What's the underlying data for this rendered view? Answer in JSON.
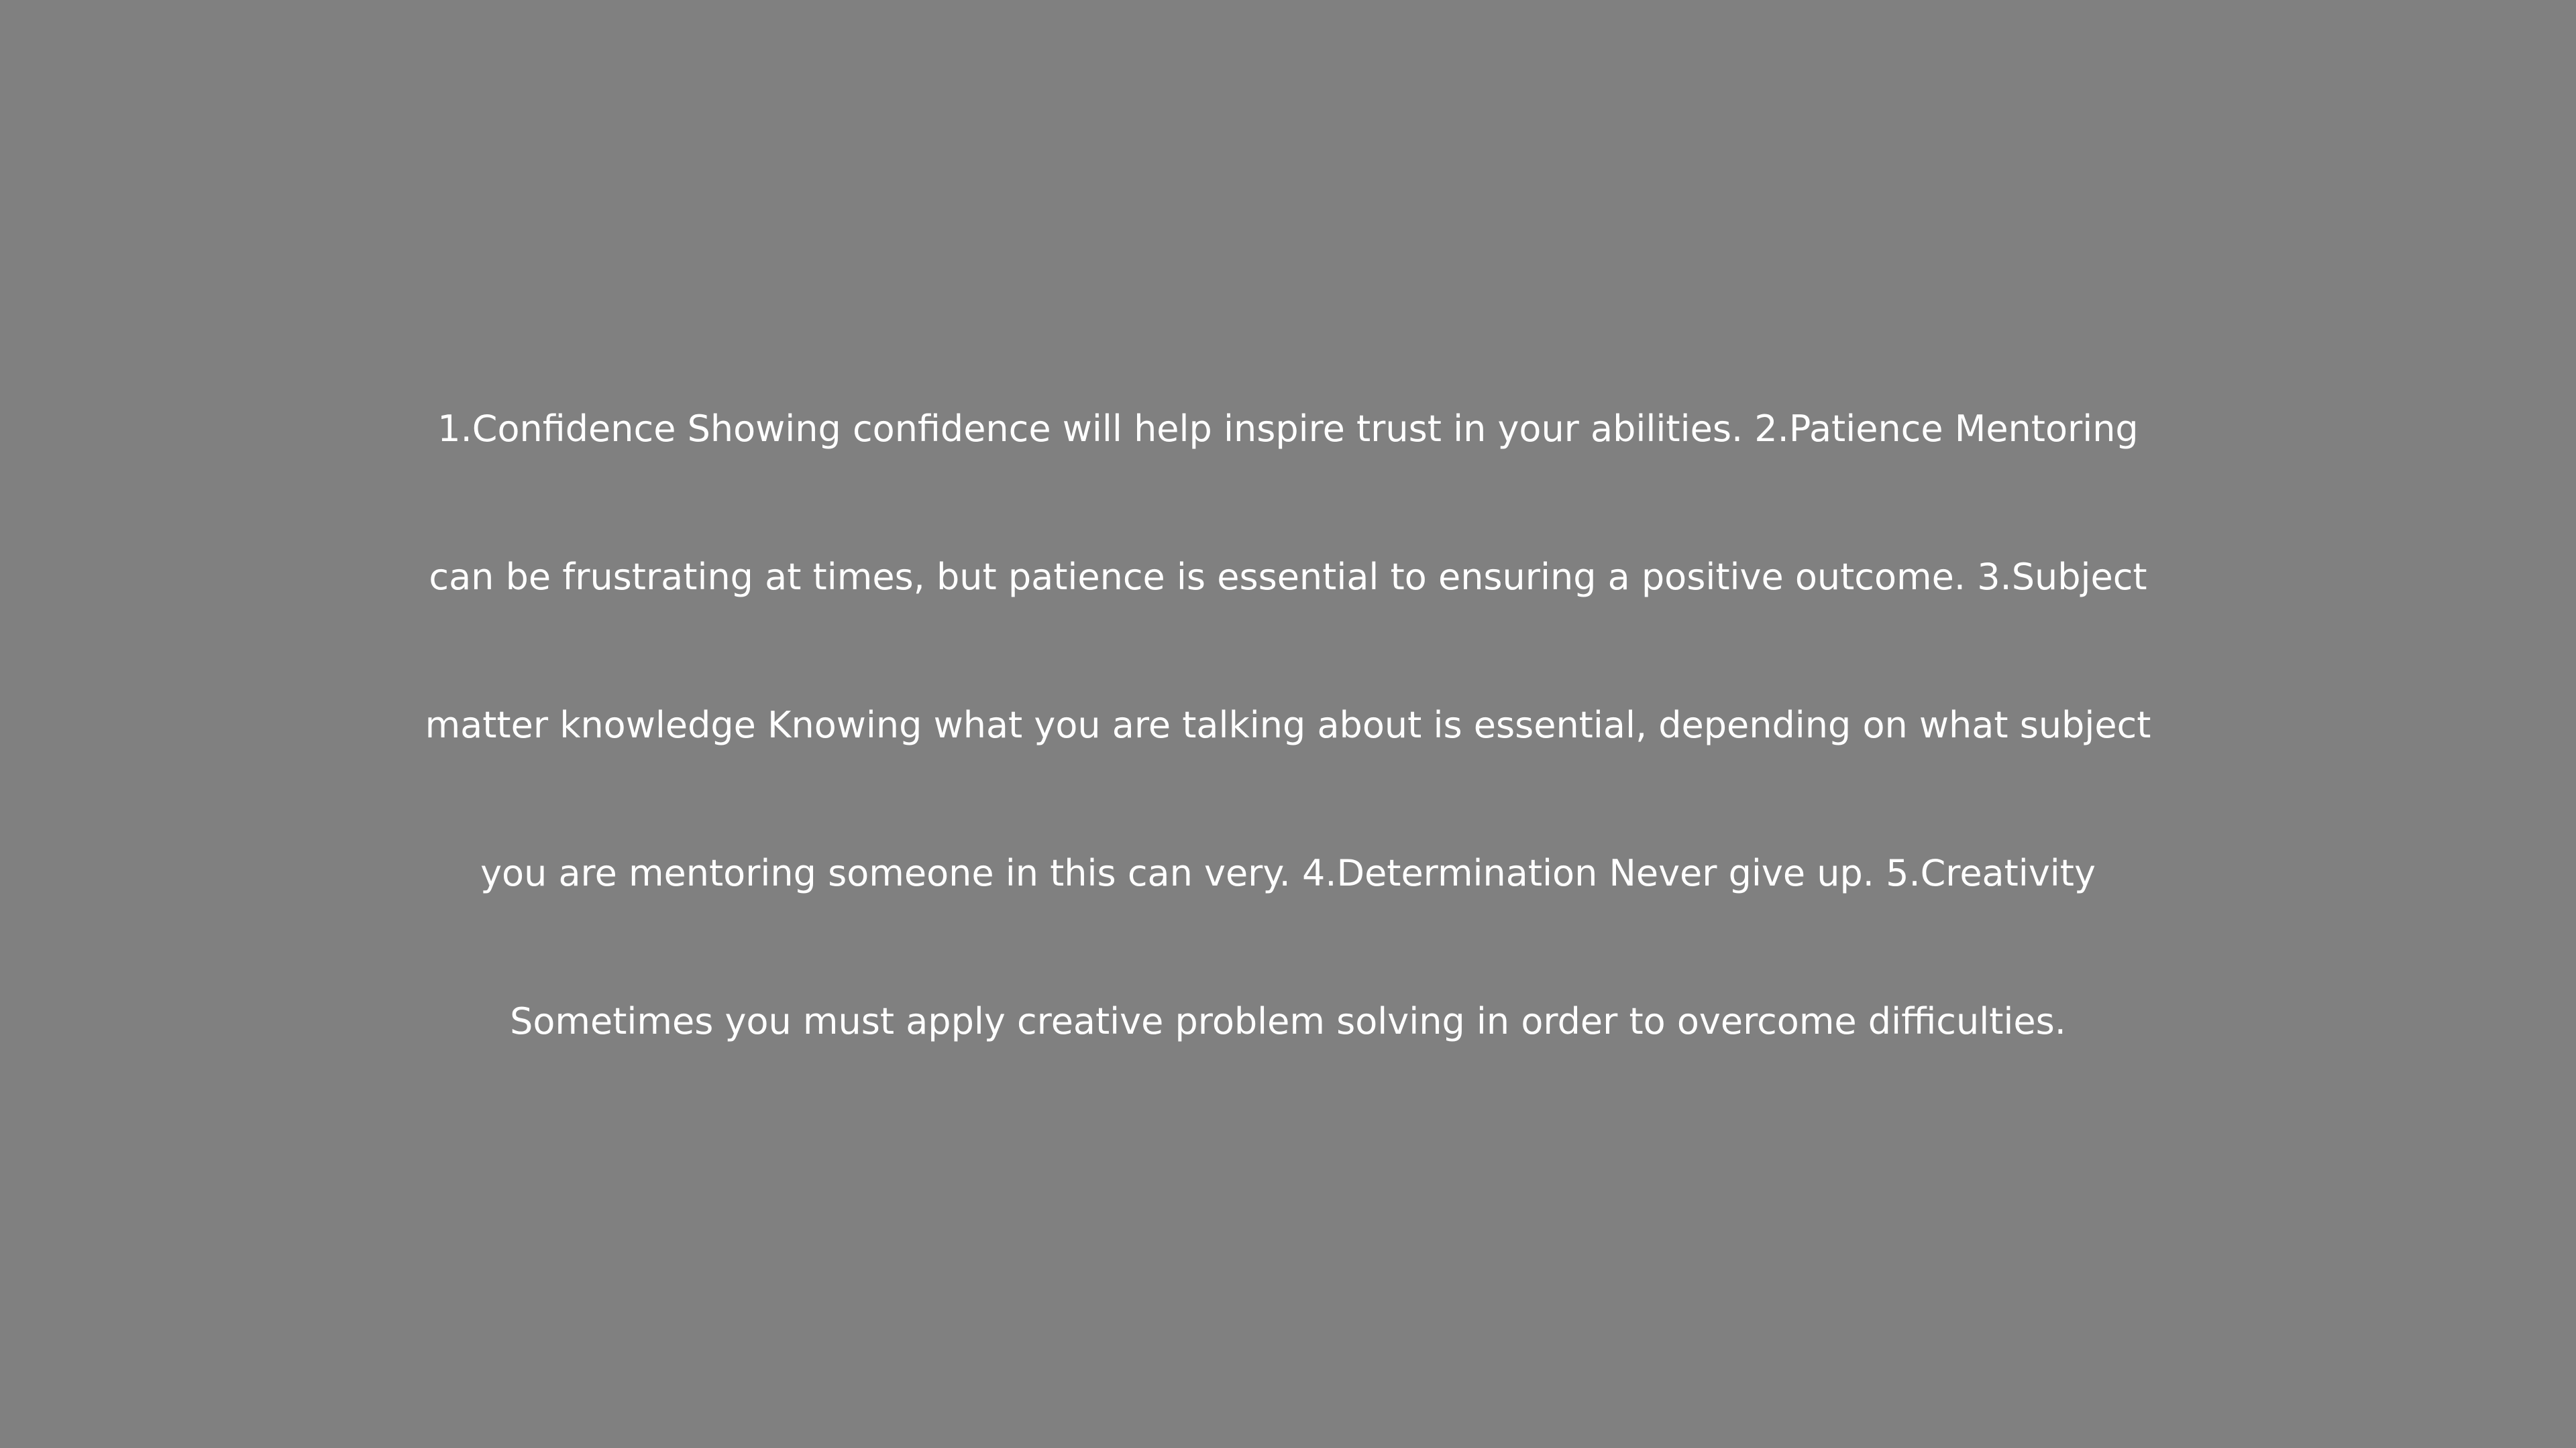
{
  "slide": {
    "background_color": "#808080",
    "text_color": "#ffffff",
    "lines": [
      "1.Confidence Showing confidence will help inspire trust in your abilities. 2.Patience Mentoring",
      "can be frustrating at times, but patience is essential to ensuring a positive outcome. 3.Subject",
      "matter knowledge Knowing what you are talking about is essential, depending on what subject",
      "you are mentoring someone in this can very. 4.Determination Never give up. 5.Creativity",
      "Sometimes you must apply creative problem solving in order to overcome difficulties."
    ]
  }
}
